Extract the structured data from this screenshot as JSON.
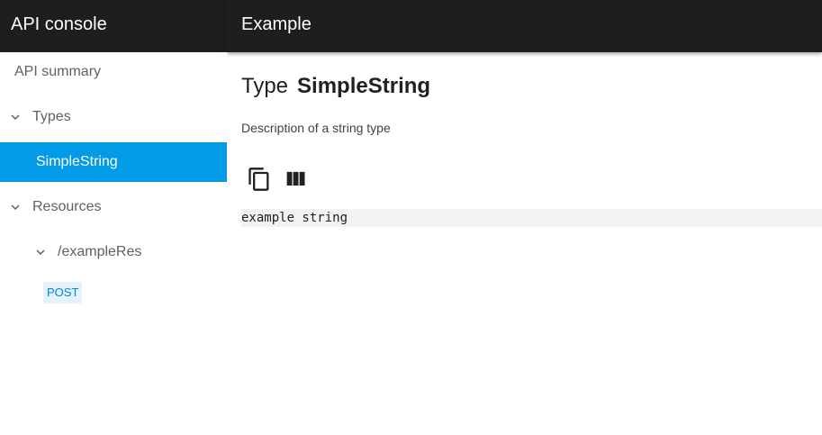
{
  "app": {
    "title": "API console"
  },
  "header": {
    "title": "Example"
  },
  "sidebar": {
    "summary_label": "API summary",
    "types_label": "Types",
    "types_items": [
      {
        "label": "SimpleString"
      }
    ],
    "resources_label": "Resources",
    "resources_items": [
      {
        "label": "/exampleRes",
        "methods": [
          {
            "label": "POST"
          }
        ]
      }
    ]
  },
  "main": {
    "type_keyword": "Type",
    "type_name": "SimpleString",
    "description": "Description of a string type",
    "example_value": "example string"
  },
  "icons": {
    "copy": "copy-icon",
    "view_columns": "view-columns-icon",
    "expand": "chevron-down-icon"
  },
  "colors": {
    "header_bg": "#1e1e1e",
    "selected_bg": "#039be5",
    "method_badge_bg": "#e3f2fd",
    "method_badge_text": "#0288d1",
    "code_bg": "#f2f2f2"
  }
}
